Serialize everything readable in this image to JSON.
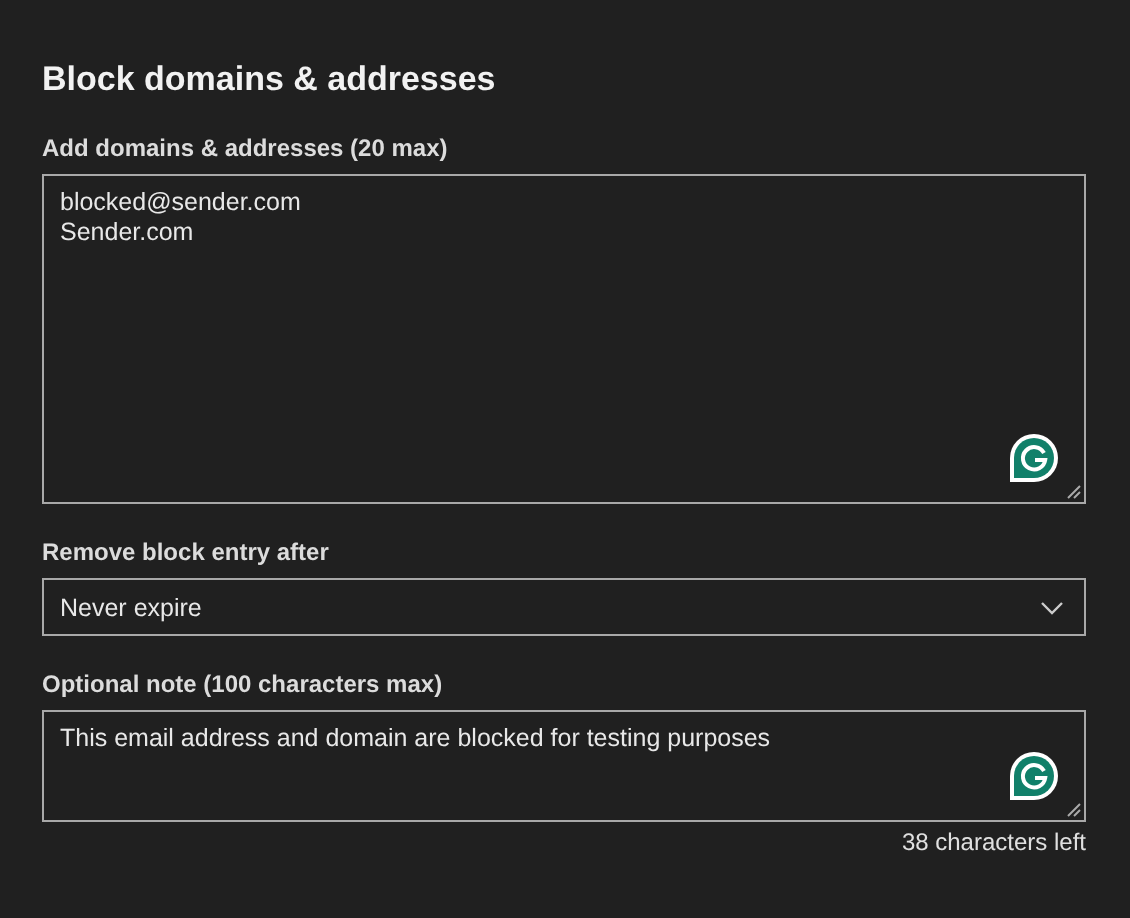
{
  "title": "Block domains & addresses",
  "fields": [
    {
      "kind": "textarea",
      "label": "Add domains & addresses (20 max)",
      "lines": [
        "blocked@sender.com",
        "Sender.com"
      ],
      "tall": true
    },
    {
      "kind": "select",
      "label": "Remove block entry after",
      "lines": [
        "Never expire"
      ]
    },
    {
      "kind": "textarea",
      "label": "Optional note (100 characters max)",
      "lines": [
        "This email address and domain are blocked for testing purposes"
      ],
      "tall": false,
      "counter": "38 characters left"
    }
  ]
}
